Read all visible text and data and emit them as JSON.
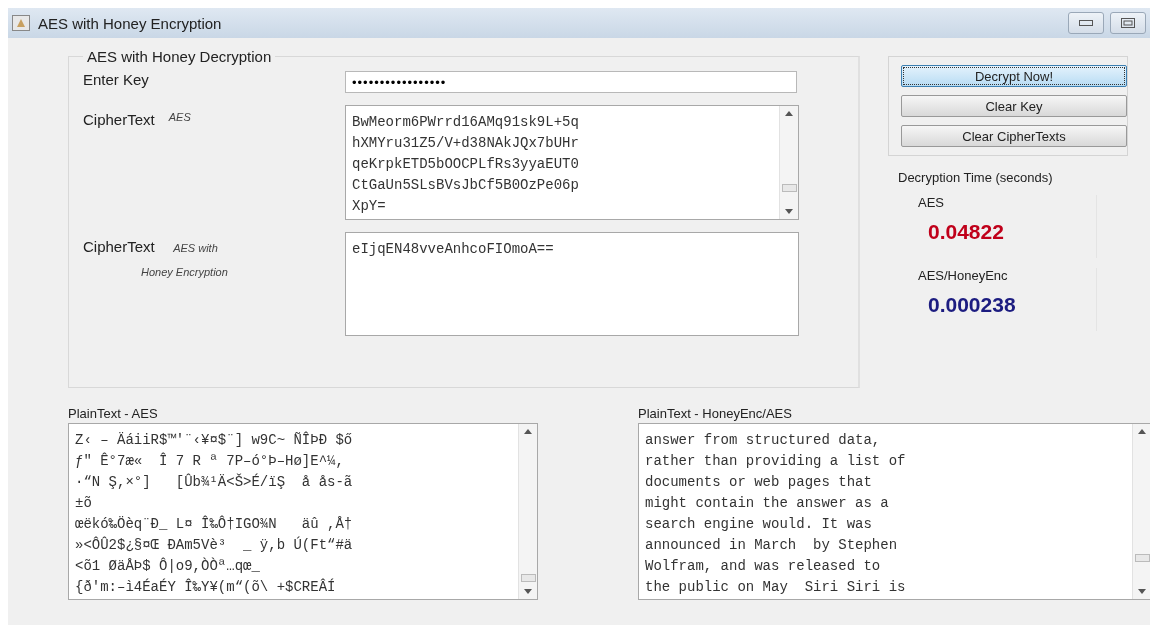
{
  "window": {
    "title": "AES with Honey Encryption"
  },
  "decryption_panel": {
    "title": "AES with Honey Decryption",
    "key": {
      "label": "Enter Key",
      "value": "•••••••••••••••••"
    },
    "cipher_aes": {
      "label": "CipherText",
      "sublabel": "AES",
      "lines": [
        "BwMeorm6PWrrd16AMq91sk9L+5q",
        "hXMYru31Z5/V+d38NAkJQx7bUHr",
        "qeKrpkETD5bOOCPLfRs3yyaEUT0",
        "CtGaUn5SLsBVsJbCf5B0OzPe06p",
        "XpY="
      ]
    },
    "cipher_honey": {
      "label": "CipherText",
      "sublabel": "AES with",
      "sublabel_2": "Honey Encryption",
      "lines": [
        "eIjqEN48vveAnhcoFIOmoA=="
      ]
    }
  },
  "buttons": [
    {
      "label": "Decrypt Now!",
      "focused": true
    },
    {
      "label": "Clear Key",
      "focused": false
    },
    {
      "label": "Clear CipherTexts",
      "focused": false
    }
  ],
  "timing": {
    "title": "Decryption Time (seconds)",
    "results": [
      {
        "label": "AES",
        "value": "0.04822",
        "color": "#c0001a"
      },
      {
        "label": "AES/HoneyEnc",
        "value": "0.000238",
        "color": "#1c1c80"
      }
    ]
  },
  "plaintext_aes": {
    "label": "PlainText - AES",
    "lines": [
      "Z‹ – ÄáiiR$™'¨‹¥¤$¨] w9C~ ÑÎÞÐ $ő",
      "ƒ\" Ê°7æ«  Î 7 R ª 7P–ó°Þ–Hø]E^¼,",
      "·“N Ş,×°]   [Ûb¾¹Ä<Š>É/ïŞ  å ås-ã",
      "±õ",
      "œëkó‰Öèq¨Ð_ L¤ Î‰Ô†IGO¾N   äû ,Å†",
      "»<ÔÛ2$¿§¤Œ ÐAm5Vè³  _ ÿ,b Ú(Ft“#ä",
      "<õ1 ØäÅÞ$ Ô|o9,ÒÒª…qœ_",
      "{ð'm:–ì4ÉaÉY Î‰Y¥(m“(õ\\ +$CREÂÍ"
    ]
  },
  "plaintext_honey": {
    "label": "PlainText - HoneyEnc/AES",
    "lines": [
      "answer from structured data,",
      "rather than providing a list of",
      "documents or web pages that",
      "might contain the answer as a",
      "search engine would. It was",
      "announced in March  by Stephen",
      "Wolfram, and was released to",
      "the public on May  Siri Siri is"
    ]
  }
}
